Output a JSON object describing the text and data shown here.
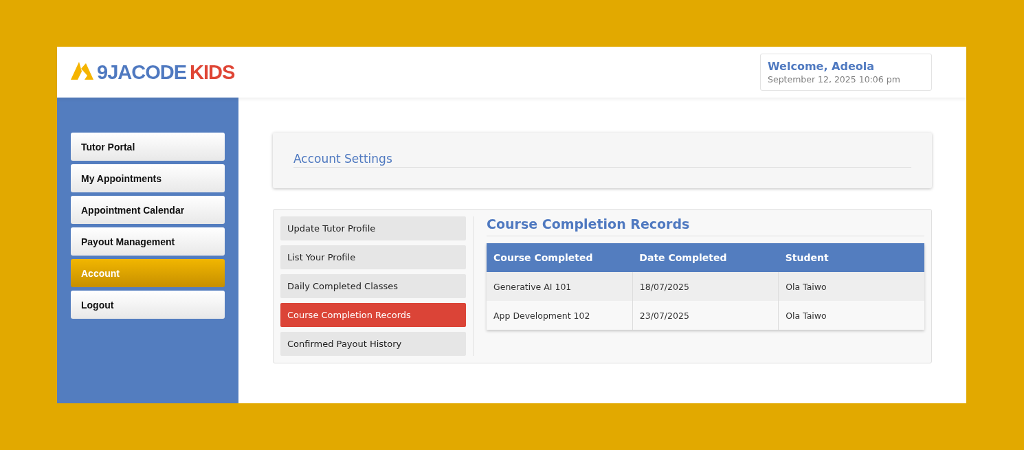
{
  "brand": {
    "name": "9JACODE",
    "suffix": "KIDS"
  },
  "welcome": {
    "greeting": "Welcome, Adeola",
    "datetime": "September 12, 2025 10:06 pm"
  },
  "sidebar": {
    "items": [
      {
        "label": "Tutor Portal",
        "selected": false
      },
      {
        "label": "My Appointments",
        "selected": false
      },
      {
        "label": "Appointment Calendar",
        "selected": false
      },
      {
        "label": "Payout Management",
        "selected": false
      },
      {
        "label": "Account",
        "selected": true
      },
      {
        "label": "Logout",
        "selected": false
      }
    ]
  },
  "page_title": "Account Settings",
  "settings_menu": [
    {
      "label": "Update Tutor Profile",
      "selected": false
    },
    {
      "label": "List Your Profile",
      "selected": false
    },
    {
      "label": "Daily Completed Classes",
      "selected": false
    },
    {
      "label": "Course Completion Records",
      "selected": true
    },
    {
      "label": "Confirmed Payout History",
      "selected": false
    }
  ],
  "records": {
    "title": "Course Completion Records",
    "columns": [
      "Course Completed",
      "Date Completed",
      "Student"
    ],
    "rows": [
      [
        "Generative AI 101",
        "18/07/2025",
        "Ola Taiwo"
      ],
      [
        "App Development 102",
        "23/07/2025",
        "Ola Taiwo"
      ]
    ]
  }
}
